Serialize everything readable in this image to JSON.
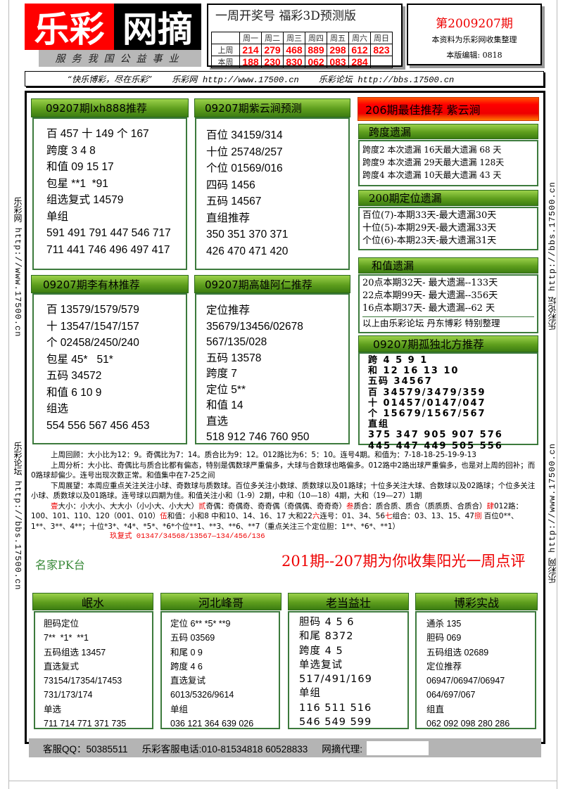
{
  "logo": {
    "part1": "乐彩",
    "part2": "网摘",
    "tagline": "服务我国公益事业"
  },
  "weekly_draws": {
    "title": "一周开奖号  福彩3D预测版",
    "days": [
      "周一",
      "周二",
      "周三",
      "周四",
      "周五",
      "周六",
      "周日"
    ],
    "rows": [
      {
        "label": "上周",
        "values": [
          "214",
          "279",
          "468",
          "889",
          "298",
          "612",
          "823"
        ]
      },
      {
        "label": "本周",
        "values": [
          "188",
          "230",
          "830",
          "062",
          "083",
          "284",
          ""
        ]
      }
    ]
  },
  "issue": {
    "number": "第2009207期",
    "note": "本资料为乐彩网收集整理",
    "editor": "本版编辑: 0818"
  },
  "slogan": {
    "quote": "“快乐博彩，尽在乐彩”",
    "site_name": "乐彩网",
    "site_url": "http://www.17500.cn",
    "forum_name": "乐彩论坛",
    "forum_url": "http://bbs.17500.cn"
  },
  "side_left": [
    {
      "name": "乐彩网",
      "url": "http://www.17500.cn"
    },
    {
      "name": "乐彩论坛",
      "url": "http://bbs.17500.cn"
    }
  ],
  "side_right": [
    {
      "name": "乐彩论坛",
      "url": "http://bbs.17500.cn"
    },
    {
      "name": "乐彩网",
      "url": "http://www.17500.cn"
    }
  ],
  "panels": {
    "lxh888": {
      "title": "09207期lxh888推荐",
      "lines": [
        "百 457 十 149 个 167",
        "跨度 3 4 8",
        "和值 09 15 17",
        "包星 **1  *91",
        "组选复式 14579",
        "单组",
        "591 491 791 447 546 717",
        "711 441 746 496 497 417"
      ]
    },
    "ziyunjian": {
      "title": "09207期紫云涧预测",
      "lines": [
        "百位 34159/314",
        "十位 25748/257",
        "个位 01569/016",
        "四码 1456",
        "五码 14567",
        "直组推荐",
        "350 351 370 371",
        "426 470 471 420"
      ]
    },
    "liyoulin": {
      "title": "09207期李有林推荐",
      "lines": [
        "百 13579/1579/579",
        "十 13547/1547/157",
        "个 02458/2450/240",
        "包星 45*   51*",
        "五码 34572",
        "和值 6 10 9",
        "组选",
        "554 556 567 456 453"
      ]
    },
    "gaoxiong": {
      "title": "09207期高雄阿仁推荐",
      "lines": [
        "定位推荐",
        "35679/13456/02678",
        "567/135/028",
        "五码 13578",
        "跨度 7",
        "定位 5**",
        "和值 14",
        "直选",
        "518 912 746 760 950"
      ]
    },
    "best": {
      "title": "206期最佳推荐 紫云涧"
    },
    "span_miss": {
      "title": "跨度遗漏",
      "lines": [
        "跨度2 本次遗漏 16天最大遗漏 68 天",
        "跨度9 本次遗漏 29天最大遗漏 128天",
        "跨度4 本次遗漏 10天最大遗漏 43 天"
      ]
    },
    "pos_miss": {
      "title": "200期定位遗漏",
      "lines": [
        "百位(7)-本期33天-最大遗漏30天",
        "十位(5)-本期29天-最大遗漏33天",
        "个位(6)-本期23天-最大遗漏31天"
      ]
    },
    "sum_miss": {
      "title": "和值遗漏",
      "lines": [
        "20点本期32天- 最大遗漏--133天",
        "22点本期99天- 最大遗漏--356天",
        "16点本期37天- 最大遗漏--62 天"
      ],
      "credit": "以上由乐彩论坛 丹东博彩 特别整理"
    },
    "gudu": {
      "title": "09207期孤独北方推荐",
      "lines": [
        "跨 4 5 9 1",
        "和 12 16 13 10",
        "五码 34567",
        "百 34579/3479/359",
        "十 01457/0147/047",
        "个 15679/1567/567",
        "直组",
        "375 347 905 907 576",
        "445 447 449 505 556"
      ]
    }
  },
  "analysis": {
    "review": "上周回顾：大小比为12：9。奇偶比为7：14。质合比为9：12。012路比为6：5：10。连号4期。和值为：7-18-18-25-19-9-13",
    "analysis": "上周分析：大小比、奇偶比与质合比都有偏态，特别是偶数球严重偏多，大球与合数球也略偏多。012路中2路出球严重偏多，也是对上周的回补；而0路球却偏少。连号出现次数正常。和值集中在7-25之间",
    "outlook": "下周展望：本周应重点关注关注小球、奇数球与质数球。百位多关注小数球、质数球以及01路球；十位多关注大球、合数球以及02路球；个位多关注小球、质数球以及01路球。连号球以四期为佳。和值关注小和（1-9）2期，中和（10—18）4期，大和（19—27）1期",
    "picks": [
      {
        "mark": "壹",
        "text": "大小：小大小、大大小（小小大、小大大）"
      },
      {
        "mark": "贰",
        "text": "奇偶：奇偶奇、奇奇偶（奇偶偶、奇奇奇）"
      },
      {
        "mark": "叁",
        "text": "质合：质合质、质合（质质质、合质合）"
      },
      {
        "mark": "肆",
        "text": "012路：100、101、110、120（001、010）"
      },
      {
        "mark": "伍",
        "text": "和值：小和8 中和10、14、16、17 大和22"
      },
      {
        "mark": "六",
        "text": "连号：01、34、56"
      },
      {
        "mark": "七",
        "text": "组合：03、13、15、47"
      },
      {
        "mark": "捌",
        "text": "  百位0**、1**、3**、4**；十位*3*、*4*、*5*、*6*个位**1、**3、**6、**7（重点关注三个定位胆：1**、*6*、**1）"
      }
    ],
    "multi": "玖复式 01347/34568/13567—134/456/136"
  },
  "mingjia": {
    "label": "名家PK台",
    "headline": "201期--207期为你收集阳光一周点评"
  },
  "pk": [
    {
      "name": "岷水",
      "lines": [
        "胆码定位",
        "7**  *1*  **1",
        "五码组选 13457",
        "直选复式",
        "73154/17354/17453",
        "731/173/174",
        "单选",
        "711 714 771 371 735"
      ]
    },
    {
      "name": "河北峰哥",
      "lines": [
        "定位 6** *5* **9",
        "五码 03569",
        "和尾 0 9",
        "跨度 4 6",
        "直选复试",
        "6013/5326/9614",
        "单组",
        "036 121 364 639 026"
      ]
    },
    {
      "name": "老当益壮",
      "lines": [
        "胆码 4 5 6",
        "和尾 8372",
        "跨度 4 5",
        "单选复试",
        "517/491/169",
        "单组",
        "116 511 516",
        "546 549 599"
      ]
    },
    {
      "name": "博彩实战",
      "lines": [
        "通杀 135",
        "胆码 069",
        "五码组选 02689",
        "定位推荐",
        "06947/06947/06947",
        "064/697/067",
        "组直",
        "062 092 098 280 286"
      ]
    }
  ],
  "footer": {
    "qq": "客服QQ：50385511",
    "phone": "乐彩客服电话:010-81534818  60528833",
    "agent_label": "网摘代理:",
    "agent_value": ""
  },
  "colors": {
    "brand_red": "#ff0000",
    "panel_green": "#5e9e1d",
    "frame_green": "#3c7a3c"
  }
}
